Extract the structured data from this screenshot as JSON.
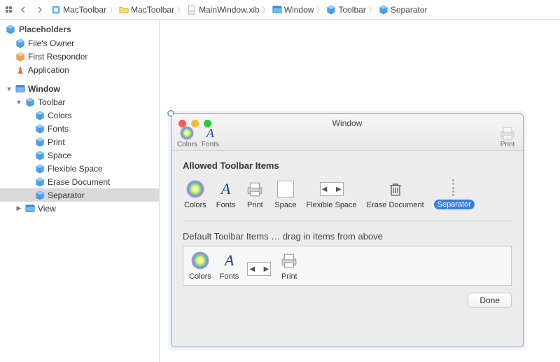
{
  "breadcrumb": [
    {
      "label": "MacToolbar",
      "icon": "xcode-proj"
    },
    {
      "label": "MacToolbar",
      "icon": "folder"
    },
    {
      "label": "MainWindow.xib",
      "icon": "xib"
    },
    {
      "label": "Window",
      "icon": "window"
    },
    {
      "label": "Toolbar",
      "icon": "cube"
    },
    {
      "label": "Separator",
      "icon": "cube"
    }
  ],
  "sidebar": {
    "placeholders_title": "Placeholders",
    "placeholders": [
      {
        "label": "File's Owner",
        "icon": "cube-blue"
      },
      {
        "label": "First Responder",
        "icon": "cube-orange"
      },
      {
        "label": "Application",
        "icon": "app"
      }
    ],
    "window_title": "Window",
    "toolbar_label": "Toolbar",
    "toolbar_items": [
      {
        "label": "Colors"
      },
      {
        "label": "Fonts"
      },
      {
        "label": "Print"
      },
      {
        "label": "Space"
      },
      {
        "label": "Flexible Space"
      },
      {
        "label": "Erase Document"
      },
      {
        "label": "Separator"
      }
    ],
    "view_label": "View"
  },
  "window": {
    "title": "Window",
    "toolbar": {
      "items": [
        {
          "label": "Colors",
          "icon": "colors"
        },
        {
          "label": "Fonts",
          "icon": "fonts"
        }
      ],
      "right": {
        "label": "Print",
        "icon": "print"
      }
    },
    "allowed_title": "Allowed Toolbar Items",
    "allowed": [
      {
        "label": "Colors",
        "icon": "colors"
      },
      {
        "label": "Fonts",
        "icon": "fonts"
      },
      {
        "label": "Print",
        "icon": "print"
      },
      {
        "label": "Space",
        "icon": "space"
      },
      {
        "label": "Flexible Space",
        "icon": "flex"
      },
      {
        "label": "Erase Document",
        "icon": "trash"
      },
      {
        "label": "Separator",
        "icon": "sep",
        "selected": true
      }
    ],
    "default_title": "Default Toolbar Items … drag in items from above",
    "default": [
      {
        "label": "Colors",
        "icon": "colors"
      },
      {
        "label": "Fonts",
        "icon": "fonts"
      },
      {
        "label": "",
        "icon": "flex"
      },
      {
        "label": "Print",
        "icon": "print"
      }
    ],
    "done": "Done"
  }
}
